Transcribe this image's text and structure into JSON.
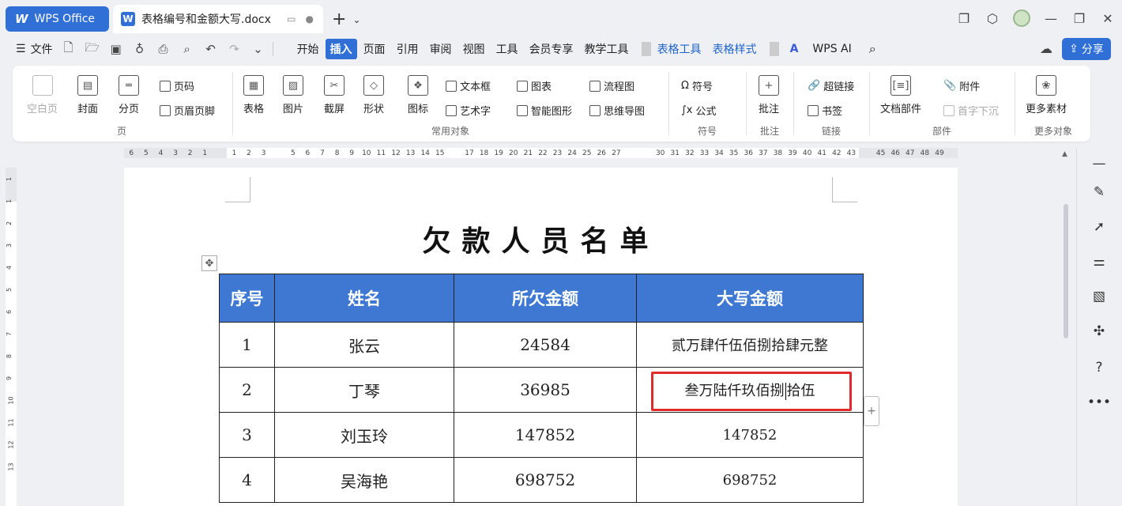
{
  "app": {
    "name": "WPS Office",
    "doc_tab": "表格编号和金额大写.docx"
  },
  "menu": {
    "file": "文件",
    "tabs": [
      "开始",
      "插入",
      "页面",
      "引用",
      "审阅",
      "视图",
      "工具",
      "会员专享",
      "教学工具"
    ],
    "context_tabs": [
      "表格工具",
      "表格样式"
    ],
    "wps_ai": "WPS AI",
    "share": "分享"
  },
  "ribbon": {
    "page_group": {
      "label": "页",
      "blank_page": "空白页",
      "cover": "封面",
      "page_break": "分页",
      "page_number": "页码",
      "header_footer": "页眉页脚"
    },
    "common_objects": {
      "label": "常用对象",
      "table": "表格",
      "picture": "图片",
      "screenshot": "截屏",
      "shape": "形状",
      "icon": "图标",
      "textbox": "文本框",
      "wordart": "艺术字",
      "chart": "图表",
      "smart_graphic": "智能图形",
      "flowchart": "流程图",
      "mindmap": "思维导图"
    },
    "symbol_group": {
      "label": "符号",
      "symbol": "符号",
      "formula": "公式"
    },
    "comment_group": {
      "label": "批注",
      "comment": "批注"
    },
    "link_group": {
      "label": "链接",
      "hyperlink": "超链接",
      "bookmark": "书签"
    },
    "parts_group": {
      "label": "部件",
      "doc_parts": "文档部件",
      "attachment": "附件",
      "drop_cap": "首字下沉"
    },
    "more_group": {
      "label": "更多对象",
      "more_materials": "更多素材"
    }
  },
  "ruler": {
    "h_numbers": [
      "6",
      "5",
      "4",
      "3",
      "2",
      "1",
      "",
      "1",
      "2",
      "3",
      "",
      "5",
      "6",
      "7",
      "8",
      "9",
      "10",
      "11",
      "12",
      "13",
      "14",
      "15",
      "",
      "17",
      "18",
      "19",
      "20",
      "21",
      "22",
      "23",
      "24",
      "25",
      "26",
      "27",
      "",
      "",
      "30",
      "31",
      "32",
      "33",
      "34",
      "35",
      "36",
      "37",
      "38",
      "39",
      "40",
      "41",
      "42",
      "43",
      "",
      "45",
      "46",
      "47",
      "48",
      "49"
    ],
    "v_numbers": [
      "1",
      "1",
      "2",
      "3",
      "4",
      "5",
      "6",
      "7",
      "8",
      "9",
      "10",
      "11",
      "12",
      "13"
    ]
  },
  "document": {
    "title": "欠款人员名单",
    "table": {
      "headers": [
        "序号",
        "姓名",
        "所欠金额",
        "大写金额"
      ],
      "rows": [
        [
          "1",
          "张云",
          "24584",
          "贰万肆仟伍佰捌拾肆元整"
        ],
        [
          "2",
          "丁琴",
          "36985",
          "叁万陆仟玖佰捌拾伍"
        ],
        [
          "3",
          "刘玉玲",
          "147852",
          "147852"
        ],
        [
          "4",
          "吴海艳",
          "698752",
          "698752"
        ]
      ]
    },
    "editing_cell_text_before": "叁万陆仟玖佰捌",
    "editing_cell_text_after": "拾伍"
  },
  "colors": {
    "accent": "#2f6fd6",
    "table_header": "#3e78d2",
    "highlight": "#e02b2b"
  }
}
